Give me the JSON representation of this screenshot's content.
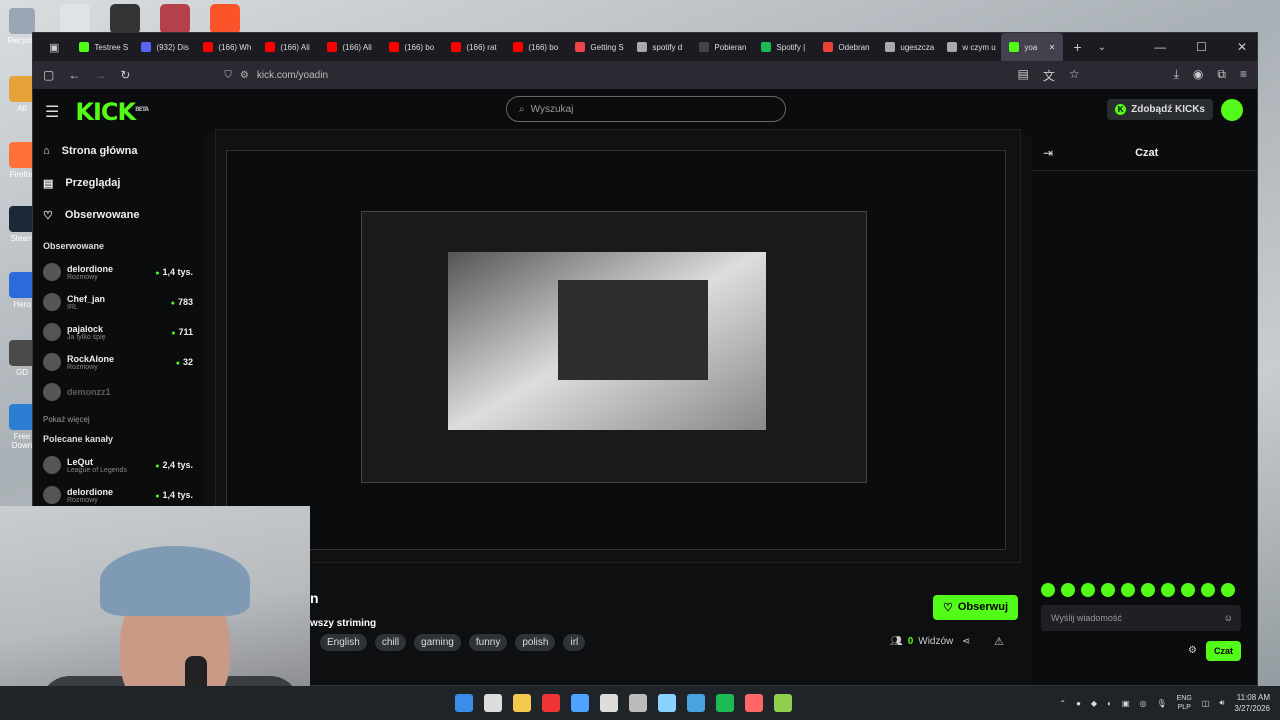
{
  "desktop": {
    "icons": [
      {
        "label": "Recycle",
        "color": "#9aa6b3"
      },
      {
        "label": "Ati",
        "color": "#e6a33a"
      },
      {
        "label": "Firefox",
        "color": "#ff7139"
      },
      {
        "label": "Steam",
        "color": "#1b2838"
      },
      {
        "label": "Hero",
        "color": "#2b6ad9"
      },
      {
        "label": "GD",
        "color": "#4a4a4a"
      },
      {
        "label": "Free Down",
        "color": "#2d7dd2"
      }
    ]
  },
  "browser": {
    "tabs": [
      {
        "label": "Testree S",
        "color": "#53fc18"
      },
      {
        "label": "(932) Dis",
        "color": "#5865f2"
      },
      {
        "label": "(166) Wh",
        "color": "#ff0000"
      },
      {
        "label": "(166) Ali",
        "color": "#ff0000"
      },
      {
        "label": "(166) Ali",
        "color": "#ff0000"
      },
      {
        "label": "(166) bo",
        "color": "#ff0000"
      },
      {
        "label": "(166) rat",
        "color": "#ff0000"
      },
      {
        "label": "(166) bo",
        "color": "#ff0000"
      },
      {
        "label": "Getting S",
        "color": "#e44"
      },
      {
        "label": "spotify d",
        "color": "#aaa"
      },
      {
        "label": "Pobieran",
        "color": "#444"
      },
      {
        "label": "Spotify |",
        "color": "#1db954"
      },
      {
        "label": "Odebran",
        "color": "#ea4335"
      },
      {
        "label": "ugeszcza",
        "color": "#aaa"
      },
      {
        "label": "w czym u",
        "color": "#aaa"
      },
      {
        "label": "yoa",
        "color": "#53fc18",
        "active": true
      }
    ],
    "url": "kick.com/yoadin"
  },
  "kick": {
    "logo": "KICK",
    "beta": "BETA",
    "search_placeholder": "Wyszukaj",
    "kicks_button": "Zdobądź KICKs",
    "nav": [
      {
        "label": "Strona główna",
        "icon": "home-icon"
      },
      {
        "label": "Przeglądaj",
        "icon": "browse-icon"
      },
      {
        "label": "Obserwowane",
        "icon": "heart-icon"
      }
    ],
    "followed_title": "Obserwowane",
    "followed": [
      {
        "name": "delordione",
        "category": "Rozmowy",
        "viewers": "1,4 tys."
      },
      {
        "name": "Chef_jan",
        "category": "IRL",
        "viewers": "783"
      },
      {
        "name": "pajalock",
        "category": "Ja tylko śpię",
        "viewers": "711"
      },
      {
        "name": "RockAlone",
        "category": "Rozmowy",
        "viewers": "32"
      },
      {
        "name": "demonzz1",
        "category": "",
        "viewers": ""
      }
    ],
    "show_more": "Pokaż więcej",
    "recommended_title": "Polecane kanały",
    "recommended": [
      {
        "name": "LeQut",
        "category": "League of Legends",
        "viewers": "2,4 tys."
      },
      {
        "name": "delordione",
        "category": "Rozmowy",
        "viewers": "1,4 tys."
      }
    ],
    "stream": {
      "channel_partial": "n",
      "title_partial": "wszy striming",
      "tags": [
        "English",
        "chill",
        "gaming",
        "funny",
        "polish",
        "irl"
      ],
      "follow_label": "Obserwuj",
      "viewers_count": "0",
      "viewers_label": "Widzów"
    },
    "chat": {
      "title": "Czat",
      "input_placeholder": "Wyślij wiadomość",
      "send_label": "Czat"
    }
  },
  "taskbar": {
    "lang1": "ENG",
    "lang2": "PLP",
    "time": "11:08 AM",
    "date": "3/27/2026"
  }
}
